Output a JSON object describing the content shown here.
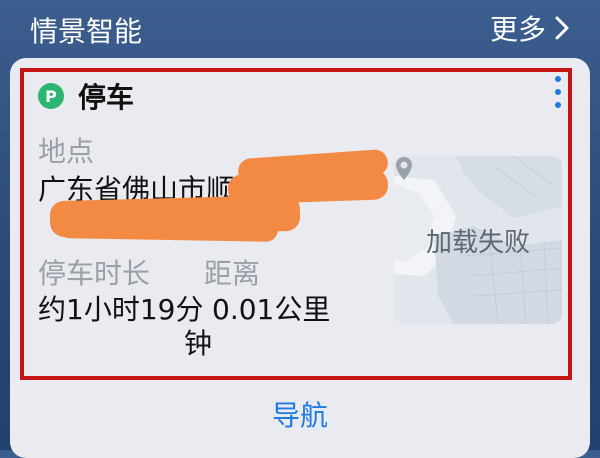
{
  "header": {
    "section_title": "情景智能",
    "more_label": "更多"
  },
  "card": {
    "title": "停车",
    "icon_letter": "P",
    "location_label": "地点",
    "location_line1": "广东省佛山市顺",
    "duration_label": "停车时长",
    "distance_label": "距离",
    "duration_value": "约1小时19分",
    "duration_suffix": "钟",
    "distance_value": "0.01公里",
    "map_status": "加载失败",
    "nav_label": "导航"
  },
  "colors": {
    "accent": "#1f7ae0",
    "parking_icon": "#2bb673",
    "highlight_border": "#c41414",
    "redaction": "#f28a44"
  }
}
